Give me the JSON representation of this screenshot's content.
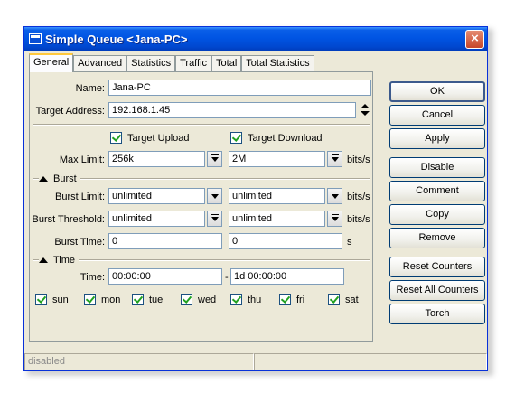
{
  "window": {
    "title": "Simple Queue <Jana-PC>",
    "close_label": "×"
  },
  "tabs": [
    "General",
    "Advanced",
    "Statistics",
    "Traffic",
    "Total",
    "Total Statistics"
  ],
  "general": {
    "name_label": "Name:",
    "name_value": "Jana-PC",
    "target_label": "Target Address:",
    "target_value": "192.168.1.45",
    "target_upload_label": "Target Upload",
    "target_upload_checked": true,
    "target_download_label": "Target Download",
    "target_download_checked": true,
    "max_limit_label": "Max Limit:",
    "max_limit_upload": "256k",
    "max_limit_download": "2M",
    "unit_bits": "bits/s",
    "burst_section": "Burst",
    "burst_limit_label": "Burst Limit:",
    "burst_limit_upload": "unlimited",
    "burst_limit_download": "unlimited",
    "burst_threshold_label": "Burst Threshold:",
    "burst_threshold_upload": "unlimited",
    "burst_threshold_download": "unlimited",
    "burst_time_label": "Burst Time:",
    "burst_time_upload": "0",
    "burst_time_download": "0",
    "unit_s": "s",
    "time_section": "Time",
    "time_label": "Time:",
    "time_from": "00:00:00",
    "time_dash": "-",
    "time_to": "1d 00:00:00",
    "days": [
      {
        "label": "sun",
        "checked": true
      },
      {
        "label": "mon",
        "checked": true
      },
      {
        "label": "tue",
        "checked": true
      },
      {
        "label": "wed",
        "checked": true
      },
      {
        "label": "thu",
        "checked": true
      },
      {
        "label": "fri",
        "checked": true
      },
      {
        "label": "sat",
        "checked": true
      }
    ]
  },
  "buttons": {
    "ok": "OK",
    "cancel": "Cancel",
    "apply": "Apply",
    "disable": "Disable",
    "comment": "Comment",
    "copy": "Copy",
    "remove": "Remove",
    "reset_counters": "Reset Counters",
    "reset_all_counters": "Reset All Counters",
    "torch": "Torch"
  },
  "status": {
    "left": "disabled",
    "right": ""
  },
  "colors": {
    "titlebar": "#0054e3",
    "window_bg": "#ece9d8",
    "check": "#21a121"
  }
}
